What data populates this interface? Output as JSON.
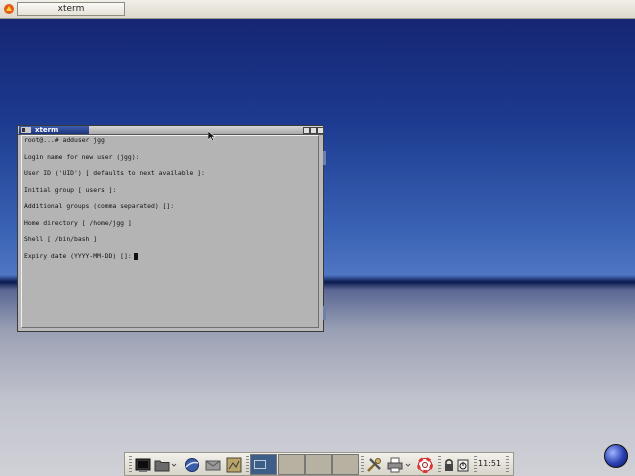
{
  "top_task_label": "xterm",
  "window": {
    "title": "xterm",
    "lines": [
      "root@...# adduser jgg",
      "Login name for new user (jgg):",
      "User ID ('UID') [ defaults to next available ]:",
      "Initial group [ users ]:",
      "Additional groups (comma separated) []:",
      "Home directory [ /home/jgg ]",
      "Shell [ /bin/bash ]",
      "Expiry date (YYYY-MM-DD) []:"
    ]
  },
  "clock": "11:51",
  "colors": {
    "desktop_top": "#14226e",
    "desktop_horizon": "#4f76c3",
    "terminal_bg": "#b4b4b4",
    "title_active": "#1d347c"
  }
}
